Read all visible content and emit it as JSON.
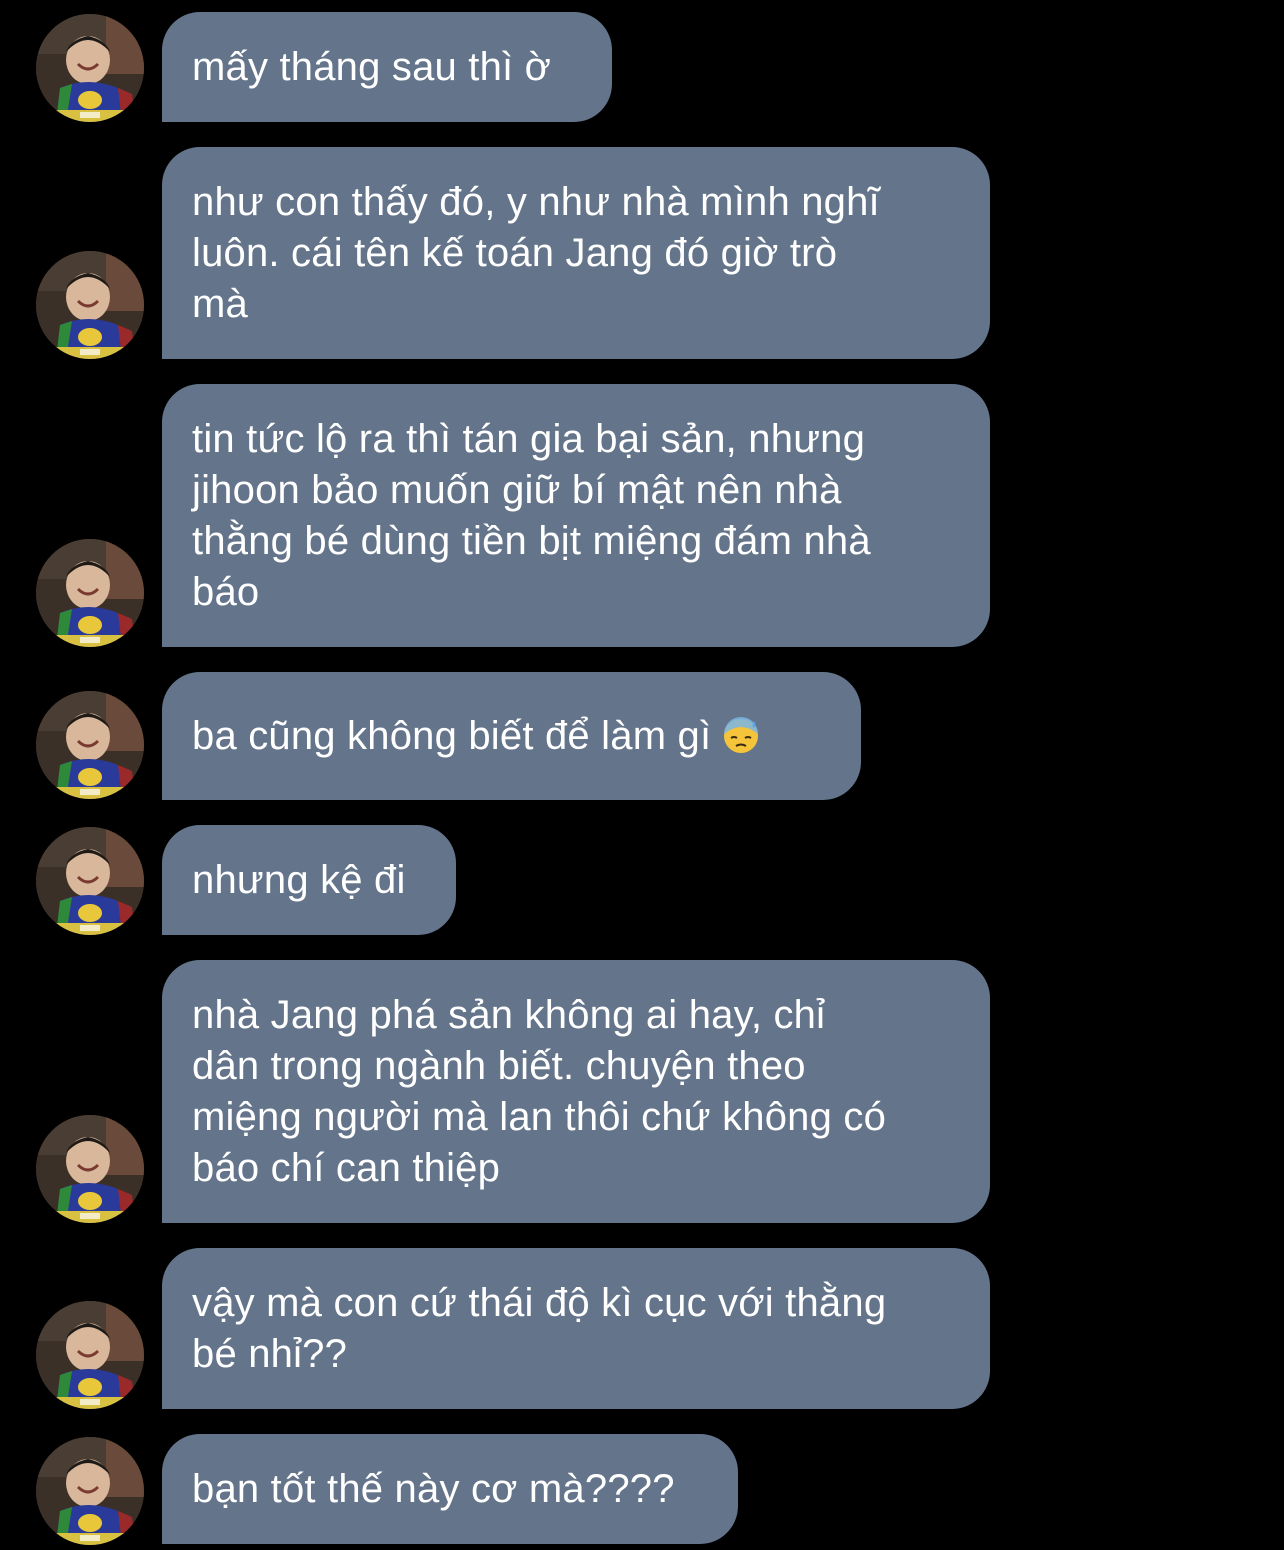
{
  "messages": [
    {
      "text": "mấy tháng sau thì ờ"
    },
    {
      "text": "như con thấy đó, y như nhà mình nghĩ\nluôn. cái tên kế toán Jang đó giờ trò\nmà"
    },
    {
      "text": "tin tức lộ ra thì tán gia bại sản, nhưng\njihoon bảo muốn giữ bí mật nên nhà\nthằng bé dùng tiền bịt miệng đám nhà\nbáo"
    },
    {
      "text": "ba cũng không biết để làm gì",
      "emoji": "downcast-face-with-sweat-emoji"
    },
    {
      "text": "nhưng kệ đi"
    },
    {
      "text": "nhà Jang phá sản không ai hay, chỉ\ndân trong ngành biết. chuyện theo\nmiệng người mà lan thôi chứ không có\nbáo chí can thiệp"
    },
    {
      "text": "vậy mà con cứ thái độ kì cục với thằng\nbé nhỉ??"
    },
    {
      "text": "bạn tốt thế này cơ mà????"
    }
  ],
  "colors": {
    "background": "#000000",
    "bubble": "#64748a",
    "text": "#ffffff"
  }
}
